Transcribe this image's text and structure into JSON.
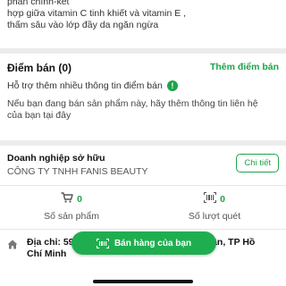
{
  "description": {
    "line1": "phần chính-kết",
    "line2": "hợp giữa vitamin C tinh khiết và vitamin E ,",
    "line3": "thấm sâu vào lớp đầy da ngăn ngừa"
  },
  "points": {
    "title": "Điểm bán (0)",
    "add_link": "Thêm điểm bán",
    "support_text": "Hỗ trợ thêm nhiều thông tin điểm bán",
    "info_icon": "!",
    "hint": "Nếu bạn đang bán sản phẩm này, hãy thêm thông tin liên hệ của bạn tại đây"
  },
  "company": {
    "owner_label": "Doanh nghiệp sở hữu",
    "name": "CÔNG TY TNHH FANIS BEAUTY",
    "detail_button": "Chi tiết",
    "stats": [
      {
        "icon": "cart-icon",
        "value": "0",
        "label": "Số sản phẩm"
      },
      {
        "icon": "barcode-scan-icon",
        "value": "0",
        "label": "Số lượt quét"
      }
    ],
    "address": "Địa chỉ: 59, ... Bình Trị Đông, Quận Bình Tân, TP Hồ Chí Minh"
  },
  "fab": {
    "label": "Bán hàng của bạn",
    "icon": "barcode-icon"
  },
  "colors": {
    "accent": "#1ea34a",
    "background": "#ececec",
    "card": "#ffffff"
  }
}
